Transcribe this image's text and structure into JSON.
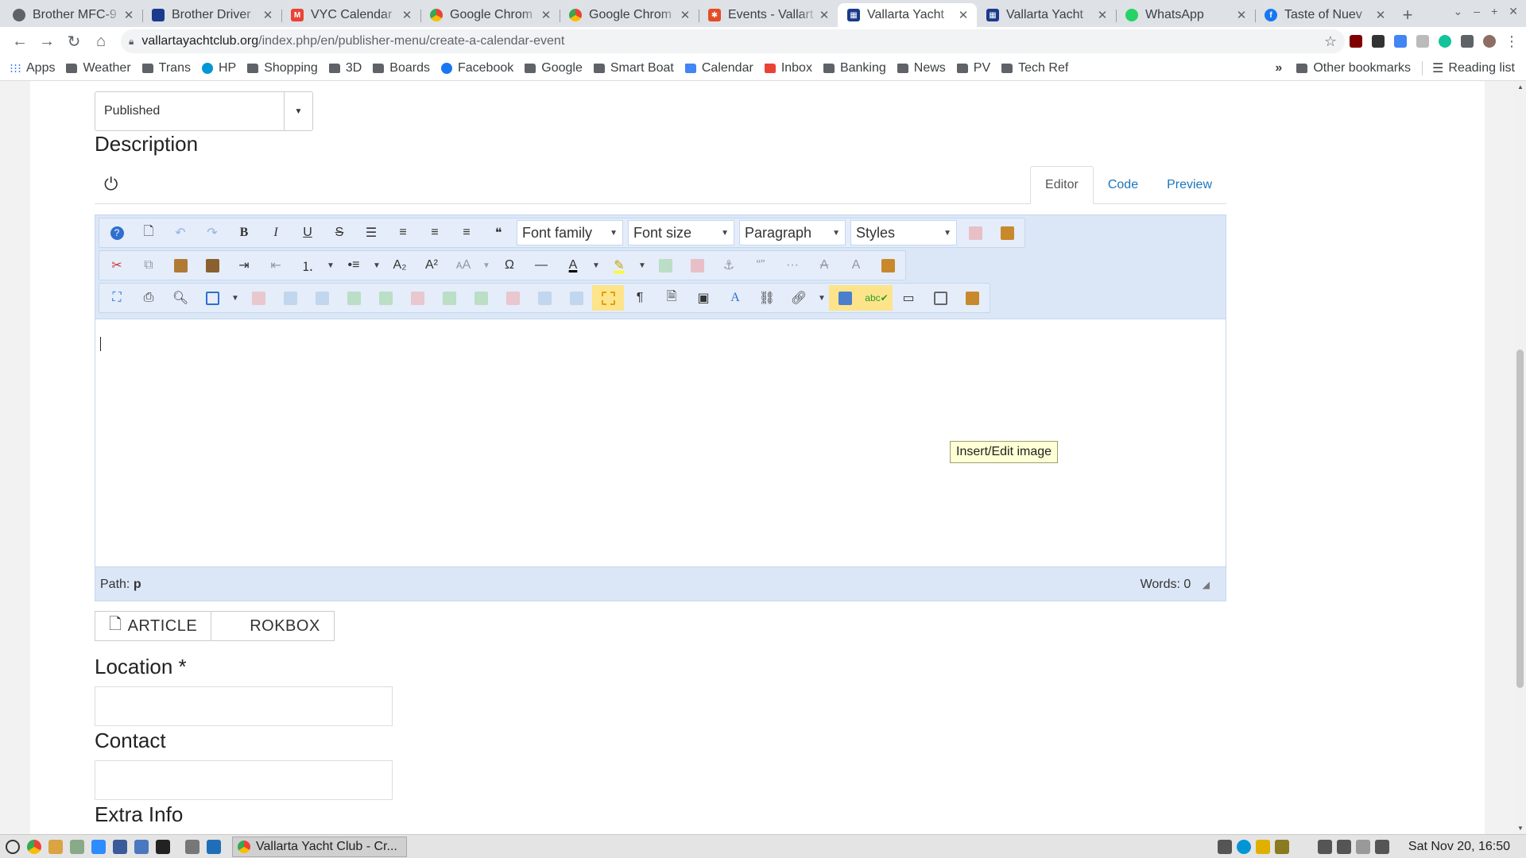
{
  "tabs": [
    {
      "label": "Brother MFC-9",
      "icon": "globe-icon",
      "color": "#5f6368"
    },
    {
      "label": "Brother Driver",
      "icon": "brother-icon",
      "color": "#1a3a8c"
    },
    {
      "label": "VYC Calendar",
      "icon": "gmail-icon",
      "color": "#ea4335"
    },
    {
      "label": "Google Chrom",
      "icon": "google-icon",
      "color": "#4285f4"
    },
    {
      "label": "Google Chrom",
      "icon": "google-icon",
      "color": "#4285f4"
    },
    {
      "label": "Events - Vallart",
      "icon": "joomla-icon",
      "color": "#e44d26"
    },
    {
      "label": "Vallarta Yacht",
      "icon": "calendar-icon",
      "color": "#1a3a8c",
      "active": true
    },
    {
      "label": "Vallarta Yacht",
      "icon": "calendar-icon",
      "color": "#1a3a8c"
    },
    {
      "label": "WhatsApp",
      "icon": "whatsapp-icon",
      "color": "#25d366"
    },
    {
      "label": "Taste of Nuev",
      "icon": "facebook-icon",
      "color": "#1877f2"
    }
  ],
  "address": {
    "host": "vallartayachtclub.org",
    "path": "/index.php/en/publisher-menu/create-a-calendar-event"
  },
  "bookmarks": [
    {
      "label": "Apps",
      "icon": "apps-icon"
    },
    {
      "label": "Weather",
      "icon": "folder-icon"
    },
    {
      "label": "Trans",
      "icon": "folder-icon"
    },
    {
      "label": "HP",
      "icon": "hp-icon"
    },
    {
      "label": "Shopping",
      "icon": "folder-icon"
    },
    {
      "label": "3D",
      "icon": "folder-icon"
    },
    {
      "label": "Boards",
      "icon": "folder-icon"
    },
    {
      "label": "Facebook",
      "icon": "facebook-icon"
    },
    {
      "label": "Google",
      "icon": "folder-icon"
    },
    {
      "label": "Smart Boat",
      "icon": "folder-icon"
    },
    {
      "label": "Calendar",
      "icon": "calendar-icon"
    },
    {
      "label": "Inbox",
      "icon": "gmail-icon"
    },
    {
      "label": "Banking",
      "icon": "folder-icon"
    },
    {
      "label": "News",
      "icon": "folder-icon"
    },
    {
      "label": "PV",
      "icon": "folder-icon"
    },
    {
      "label": "Tech Ref",
      "icon": "folder-icon"
    }
  ],
  "bookmarks_right": {
    "more": "»",
    "other": "Other bookmarks",
    "reading": "Reading list"
  },
  "form": {
    "state_value": "Published",
    "description_label": "Description",
    "editor_tabs": [
      "Editor",
      "Code",
      "Preview"
    ],
    "lists": {
      "font_family": "Font family",
      "font_size": "Font size",
      "format": "Paragraph",
      "styles": "Styles"
    },
    "tooltip": "Insert/Edit image",
    "path_label": "Path:",
    "path_value": "p",
    "words_label": "Words: 0",
    "btn_article": "ARTICLE",
    "btn_rokbox": "ROKBOX",
    "location_label": "Location *",
    "contact_label": "Contact",
    "extra_label": "Extra Info"
  },
  "taskbar": {
    "task_label": "Vallarta Yacht Club - Cr...",
    "clock": "Sat Nov 20, 16:50"
  }
}
